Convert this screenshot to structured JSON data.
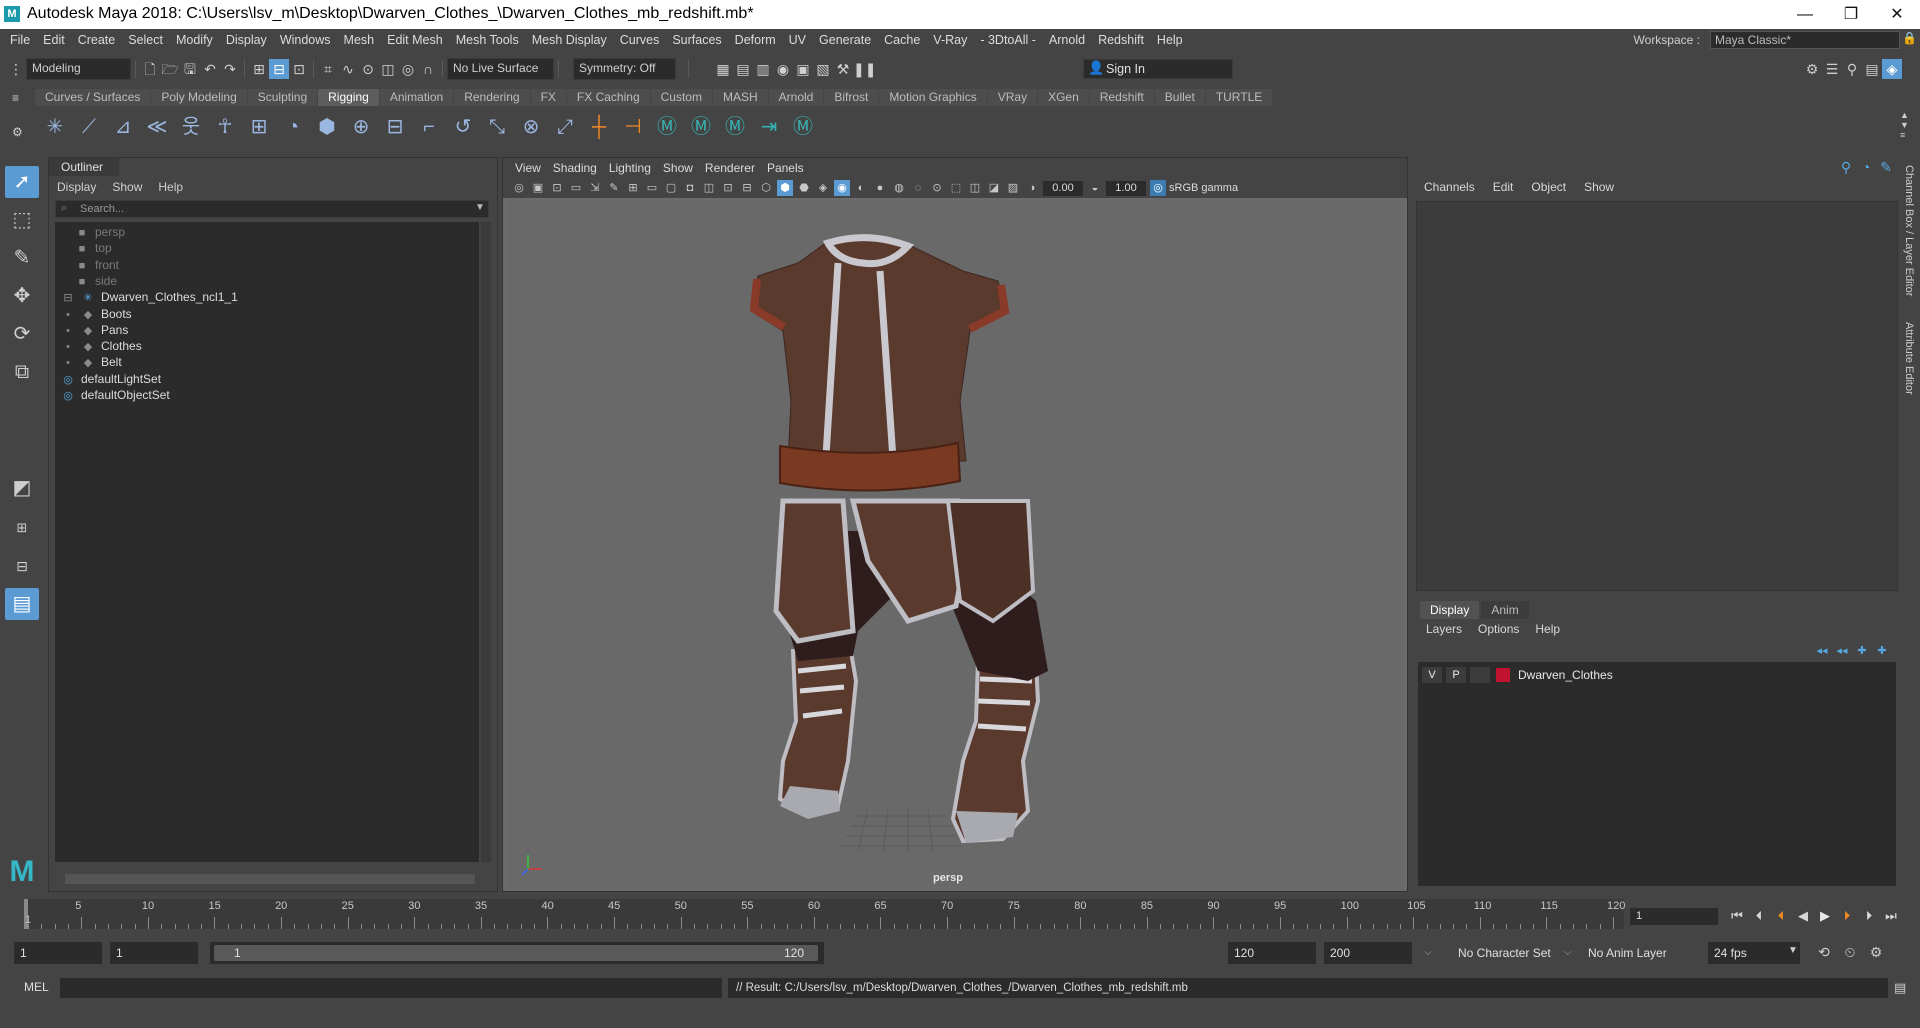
{
  "window": {
    "title": "Autodesk Maya 2018: C:\\Users\\lsv_m\\Desktop\\Dwarven_Clothes_\\Dwarven_Clothes_mb_redshift.mb*",
    "app_icon": "M",
    "minimize_icon": "—",
    "restore_icon": "❐",
    "close_icon": "✕"
  },
  "menubar": {
    "items": [
      "File",
      "Edit",
      "Create",
      "Select",
      "Modify",
      "Display",
      "Windows",
      "Mesh",
      "Edit Mesh",
      "Mesh Tools",
      "Mesh Display",
      "Curves",
      "Surfaces",
      "Deform",
      "UV",
      "Generate",
      "Cache",
      "V-Ray",
      "- 3DtoAll -",
      "Arnold",
      "Redshift",
      "Help"
    ],
    "workspace_label": "Workspace :",
    "workspace_value": "Maya Classic*"
  },
  "statusline": {
    "mode": "Modeling",
    "live_surface": "No Live Surface",
    "symmetry": "Symmetry: Off",
    "sign_in": "Sign In"
  },
  "shelf": {
    "tabs": [
      "Curves / Surfaces",
      "Poly Modeling",
      "Sculpting",
      "Rigging",
      "Animation",
      "Rendering",
      "FX",
      "FX Caching",
      "Custom",
      "MASH",
      "Arnold",
      "Bifrost",
      "Motion Graphics",
      "VRay",
      "XGen",
      "Redshift",
      "Bullet",
      "TURTLE"
    ],
    "active_tab": "Rigging"
  },
  "outliner": {
    "tab": "Outliner",
    "menu": [
      "Display",
      "Show",
      "Help"
    ],
    "search_placeholder": "Search...",
    "items": [
      {
        "label": "persp",
        "icon": "camera-icon",
        "dim": true,
        "indent": 1
      },
      {
        "label": "top",
        "icon": "camera-icon",
        "dim": true,
        "indent": 1
      },
      {
        "label": "front",
        "icon": "camera-icon",
        "dim": true,
        "indent": 1
      },
      {
        "label": "side",
        "icon": "camera-icon",
        "dim": true,
        "indent": 1
      },
      {
        "label": "Dwarven_Clothes_ncl1_1",
        "icon": "joint-icon",
        "dim": false,
        "indent": 0
      },
      {
        "label": "Boots",
        "icon": "mesh-icon",
        "dim": false,
        "indent": 1
      },
      {
        "label": "Pans",
        "icon": "mesh-icon",
        "dim": false,
        "indent": 1
      },
      {
        "label": "Clothes",
        "icon": "mesh-icon",
        "dim": false,
        "indent": 1
      },
      {
        "label": "Belt",
        "icon": "mesh-icon",
        "dim": false,
        "indent": 1
      },
      {
        "label": "defaultLightSet",
        "icon": "set-icon",
        "dim": false,
        "indent": 0
      },
      {
        "label": "defaultObjectSet",
        "icon": "set-icon",
        "dim": false,
        "indent": 0
      }
    ]
  },
  "viewport": {
    "menu": [
      "View",
      "Shading",
      "Lighting",
      "Show",
      "Renderer",
      "Panels"
    ],
    "exposure": "0.00",
    "gamma": "1.00",
    "color_space": "sRGB gamma",
    "camera_label": "persp",
    "colors": {
      "leather": "#5b3a2e",
      "trim": "#bdbdc3",
      "belt": "#7a3a22",
      "pants": "#2e1d1c",
      "background": "#696969"
    }
  },
  "channelbox": {
    "menu": [
      "Channels",
      "Edit",
      "Object",
      "Show"
    ],
    "side_tabs": [
      "Channel Box / Layer Editor",
      "Attribute Editor"
    ]
  },
  "layer_editor": {
    "tabs": [
      "Display",
      "Anim"
    ],
    "active_tab": "Display",
    "menu": [
      "Layers",
      "Options",
      "Help"
    ],
    "layer": {
      "v": "V",
      "p": "P",
      "name": "Dwarven_Clothes",
      "color": "#c1122f"
    }
  },
  "timeline": {
    "ticks": [
      5,
      10,
      15,
      20,
      25,
      30,
      35,
      40,
      45,
      50,
      55,
      60,
      65,
      70,
      75,
      80,
      85,
      90,
      95,
      100,
      105,
      110,
      115,
      120
    ],
    "start_label": "1",
    "current_frame": "1"
  },
  "range": {
    "start": "1",
    "playback_start": "1",
    "slider_start": "1",
    "slider_end": "120",
    "playback_end": "120",
    "end": "200",
    "character_set": "No Character Set",
    "anim_layer": "No Anim Layer",
    "fps": "24 fps"
  },
  "cmdline": {
    "label": "MEL",
    "result": "// Result: C:/Users/lsv_m/Desktop/Dwarven_Clothes_/Dwarven_Clothes_mb_redshift.mb"
  }
}
